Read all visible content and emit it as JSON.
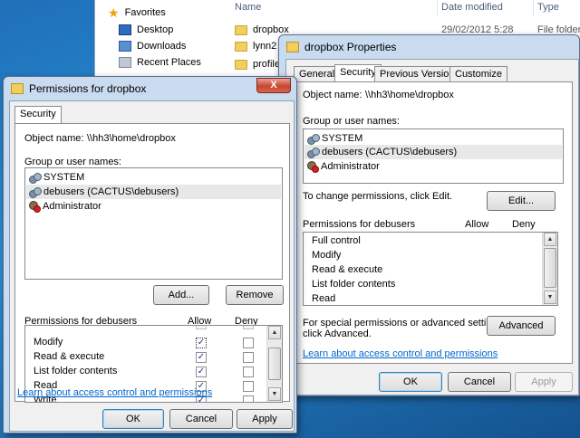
{
  "explorer": {
    "nav": {
      "favorites": "Favorites",
      "desktop": "Desktop",
      "downloads": "Downloads",
      "recent": "Recent Places"
    },
    "columns": {
      "name": "Name",
      "date": "Date modified",
      "type": "Type"
    },
    "files": [
      {
        "name": "dropbox",
        "date": "29/02/2012 5:28",
        "type": "File folder"
      },
      {
        "name": "lynn2",
        "date": "",
        "type": ""
      },
      {
        "name": "profiles",
        "date": "",
        "type": ""
      }
    ]
  },
  "props": {
    "title": "dropbox Properties",
    "tabs": [
      "General",
      "Security",
      "Previous Versions",
      "Customize"
    ],
    "object_label": "Object name:",
    "object_value": "\\\\hh3\\home\\dropbox",
    "group_label": "Group or user names:",
    "users": [
      "SYSTEM",
      "debusers (CACTUS\\debusers)",
      "Administrator"
    ],
    "change_text": "To change permissions, click Edit.",
    "edit_button": "Edit...",
    "perm_label": "Permissions for debusers",
    "allow": "Allow",
    "deny": "Deny",
    "permissions": [
      "Full control",
      "Modify",
      "Read & execute",
      "List folder contents",
      "Read"
    ],
    "special_text_1": "For special permissions or advanced settings,",
    "special_text_2": "click Advanced.",
    "advanced_button": "Advanced",
    "learn_link": "Learn about access control and permissions",
    "ok": "OK",
    "cancel": "Cancel",
    "apply": "Apply"
  },
  "perm": {
    "title": "Permissions for dropbox",
    "close": "X",
    "tab": "Security",
    "object_label": "Object name:",
    "object_value": "\\\\hh3\\home\\dropbox",
    "group_label": "Group or user names:",
    "users": [
      "SYSTEM",
      "debusers (CACTUS\\debusers)",
      "Administrator"
    ],
    "add_button": "Add...",
    "remove_button": "Remove",
    "perm_label": "Permissions for debusers",
    "allow": "Allow",
    "deny": "Deny",
    "permissions": [
      {
        "name": "Modify",
        "allow": true,
        "deny": false
      },
      {
        "name": "Read & execute",
        "allow": true,
        "deny": false
      },
      {
        "name": "List folder contents",
        "allow": true,
        "deny": false
      },
      {
        "name": "Read",
        "allow": true,
        "deny": false
      },
      {
        "name": "Write",
        "allow": true,
        "deny": false
      }
    ],
    "learn_link": "Learn about access control and permissions",
    "ok": "OK",
    "cancel": "Cancel",
    "apply": "Apply",
    "check_glyph": "✓"
  }
}
